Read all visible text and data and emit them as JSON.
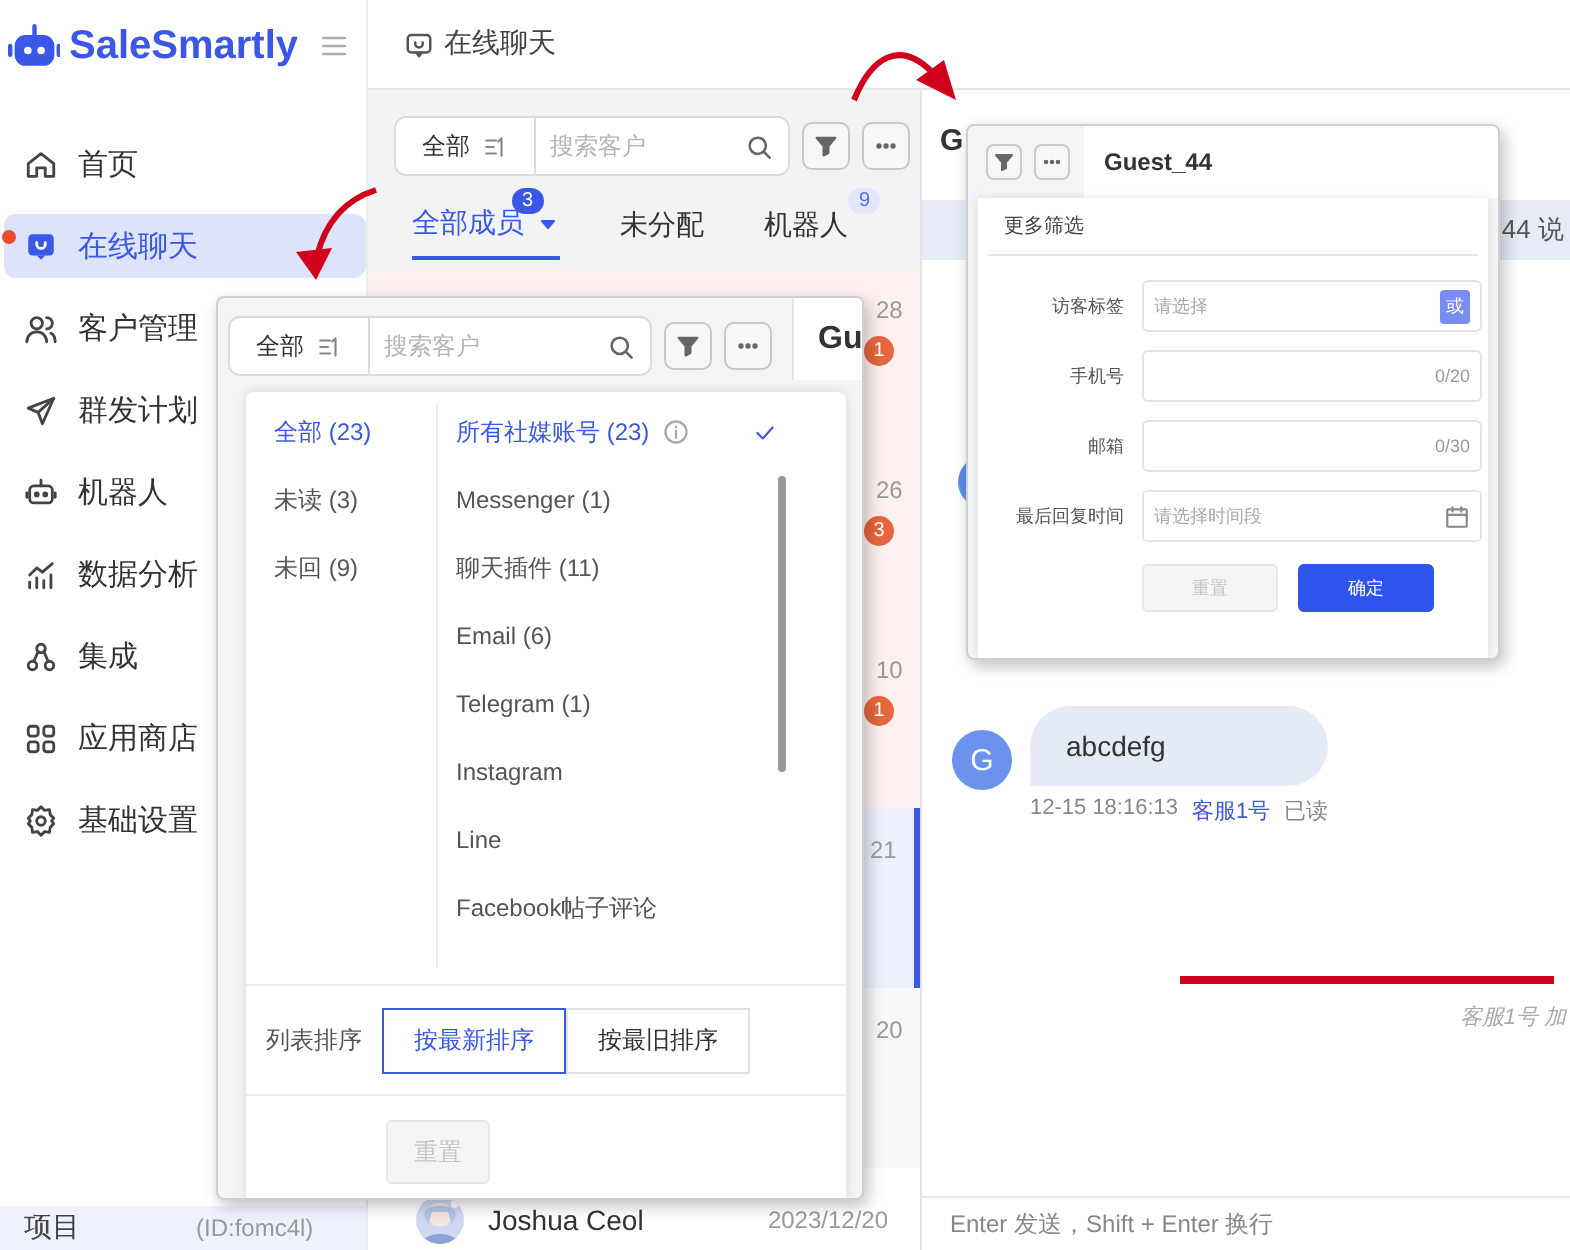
{
  "sidebar": {
    "brand": "SaleSmartly",
    "items": [
      {
        "label": "首页",
        "selected": false,
        "dot": false
      },
      {
        "label": "在线聊天",
        "selected": true,
        "dot": true
      },
      {
        "label": "客户管理",
        "selected": false,
        "dot": false
      },
      {
        "label": "群发计划",
        "selected": false,
        "dot": false
      },
      {
        "label": "机器人",
        "selected": false,
        "dot": false
      },
      {
        "label": "数据分析",
        "selected": false,
        "dot": false
      },
      {
        "label": "集成",
        "selected": false,
        "dot": false
      },
      {
        "label": "应用商店",
        "selected": false,
        "dot": false
      },
      {
        "label": "基础设置",
        "selected": false,
        "dot": false
      }
    ],
    "footer": {
      "label": "项目",
      "id": "(ID:fomc4l)"
    }
  },
  "header": {
    "title": "在线聊天"
  },
  "conversation_list": {
    "toolbar": {
      "scope": "全部",
      "placeholder": "搜索客户"
    },
    "tabs": [
      {
        "label": "全部成员",
        "selected": true,
        "badge": "3"
      },
      {
        "label": "未分配",
        "selected": false
      },
      {
        "label": "机器人",
        "selected": false,
        "badge": "9"
      }
    ],
    "rows": [
      {
        "time": "28",
        "unread": "1",
        "selected": false
      },
      {
        "time": "26",
        "unread": "3",
        "selected": false
      },
      {
        "time": "10",
        "unread": "1",
        "selected": false
      },
      {
        "time": "21",
        "selected": true
      },
      {
        "time": "20",
        "selected": false
      },
      {
        "name": "Joshua Ceol",
        "time": "2023/12/20",
        "selected": false
      }
    ]
  },
  "chat": {
    "title": "G",
    "notice": "44 说",
    "messages": [
      {
        "avatar": "G",
        "text": "abcdefg",
        "time": "12-15 18:16:13",
        "agent": "客服1号",
        "status": "已读"
      }
    ],
    "system_note": "客服1号 加",
    "composer": {
      "placeholder": "Enter 发送，Shift + Enter 换行"
    }
  },
  "dropdown": {
    "toolbar": {
      "scope": "全部",
      "placeholder": "搜索客户",
      "title_fragment": "Gu"
    },
    "statuses": [
      {
        "label": "全部 (23)",
        "selected": true
      },
      {
        "label": "未读 (3)",
        "selected": false
      },
      {
        "label": "未回 (9)",
        "selected": false
      }
    ],
    "channels": [
      {
        "label": "所有社媒账号 (23)",
        "selected": true,
        "info": true
      },
      {
        "label": "Messenger (1)",
        "selected": false
      },
      {
        "label": "聊天插件 (11)",
        "selected": false
      },
      {
        "label": "Email (6)",
        "selected": false
      },
      {
        "label": "Telegram (1)",
        "selected": false
      },
      {
        "label": "Instagram",
        "selected": false
      },
      {
        "label": "Line",
        "selected": false
      },
      {
        "label": "Facebook帖子评论",
        "selected": false
      }
    ],
    "sort": {
      "label": "列表排序",
      "options": [
        {
          "label": "按最新排序",
          "selected": true
        },
        {
          "label": "按最旧排序",
          "selected": false
        }
      ]
    },
    "reset": {
      "label": "重置",
      "disabled": true
    }
  },
  "filter_popup": {
    "title": "Guest_44",
    "heading": "更多筛选",
    "fields": [
      {
        "kind": "select",
        "label": "访客标签",
        "placeholder": "请选择",
        "tag": "或"
      },
      {
        "kind": "text",
        "label": "手机号",
        "counter": "0/20"
      },
      {
        "kind": "text",
        "label": "邮箱",
        "counter": "0/30"
      },
      {
        "kind": "date",
        "label": "最后回复时间",
        "placeholder": "请选择时间段"
      }
    ],
    "buttons": [
      {
        "label": "重置",
        "kind": "default",
        "disabled": true
      },
      {
        "label": "确定",
        "kind": "primary",
        "disabled": false
      }
    ]
  },
  "annotations": [
    {
      "kind": "arrow_down"
    },
    {
      "kind": "arrow_right"
    },
    {
      "kind": "underline"
    }
  ]
}
